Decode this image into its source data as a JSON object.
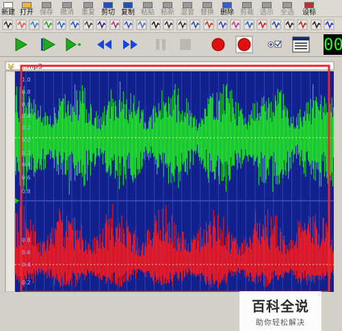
{
  "toolbar": {
    "buttons": [
      {
        "label": "新建",
        "icon": "new-doc-icon",
        "disabled": false
      },
      {
        "label": "打开",
        "icon": "open-folder-icon",
        "disabled": false
      },
      {
        "label": "保存",
        "icon": "save-icon",
        "disabled": true
      },
      {
        "label": "撤消",
        "icon": "undo-icon",
        "disabled": true
      },
      {
        "label": "重复",
        "icon": "redo-icon",
        "disabled": true
      },
      {
        "label": "剪切",
        "icon": "cut-icon",
        "disabled": false
      },
      {
        "label": "复制",
        "icon": "copy-icon",
        "disabled": false
      },
      {
        "label": "粘贴",
        "icon": "paste-icon",
        "disabled": true
      },
      {
        "label": "粘新",
        "icon": "paste-new-icon",
        "disabled": true
      },
      {
        "label": "混音",
        "icon": "mix-icon",
        "disabled": true
      },
      {
        "label": "替换",
        "icon": "replace-icon",
        "disabled": true
      },
      {
        "label": "删除",
        "icon": "delete-icon",
        "disabled": false
      },
      {
        "label": "剪裁",
        "icon": "trim-icon",
        "disabled": true
      },
      {
        "label": "选示",
        "icon": "show-selection-icon",
        "disabled": true
      },
      {
        "label": "全选",
        "icon": "select-all-icon",
        "disabled": true
      },
      {
        "label": "设标",
        "icon": "set-marker-icon",
        "disabled": false
      }
    ]
  },
  "effects_toolbar": {
    "icons": [
      "silence-icon",
      "fade-icon",
      "normalize-icon",
      "reverse-icon",
      "invert-icon",
      "stretch-icon",
      "amplify-icon",
      "fade-in-icon",
      "filter-icon",
      "echo-icon",
      "equalizer-icon",
      "loop-icon",
      "shift-left-icon",
      "shift-right-icon",
      "spectrum-icon",
      "noise-icon",
      "vocal-icon",
      "pitch-icon",
      "speed-icon",
      "compress-icon",
      "envelope-icon",
      "flanger-icon",
      "chorus-icon",
      "reverb-icon",
      "more-effects-icon"
    ]
  },
  "transport": {
    "buttons": [
      {
        "name": "play-button",
        "icon": "play-icon"
      },
      {
        "name": "play-loop-button",
        "icon": "play-loop-icon"
      },
      {
        "name": "play-to-end-button",
        "icon": "play-to-end-icon"
      },
      {
        "name": "rewind-button",
        "icon": "rewind-icon"
      },
      {
        "name": "fast-forward-button",
        "icon": "fast-forward-icon"
      },
      {
        "name": "pause-button",
        "icon": "pause-icon"
      },
      {
        "name": "stop-button",
        "icon": "stop-icon"
      },
      {
        "name": "record-button",
        "icon": "record-icon"
      },
      {
        "name": "record-new-button",
        "icon": "record-new-icon"
      },
      {
        "name": "monitor-button",
        "icon": "monitor-icon"
      },
      {
        "name": "view-window-button",
        "icon": "window-icon"
      }
    ],
    "time": "00"
  },
  "waveform": {
    "title": "...mp3",
    "green_channel_labels": [
      "1.0",
      "0.8",
      "0.6",
      "0.4",
      "0.2",
      "0.0",
      "0.2",
      "0.4",
      "0.6",
      "0.8"
    ],
    "red_channel_labels": [
      "0.8",
      "0.6",
      "0.4",
      "0.2"
    ],
    "colors": {
      "background": "#13218f",
      "left_channel": "#22ee22",
      "right_channel": "#ff1a1a",
      "selection": "#e8262b",
      "grid": "#3a52c8"
    }
  },
  "watermark": {
    "title": "百科全说",
    "subtitle": "助你轻松解决"
  }
}
